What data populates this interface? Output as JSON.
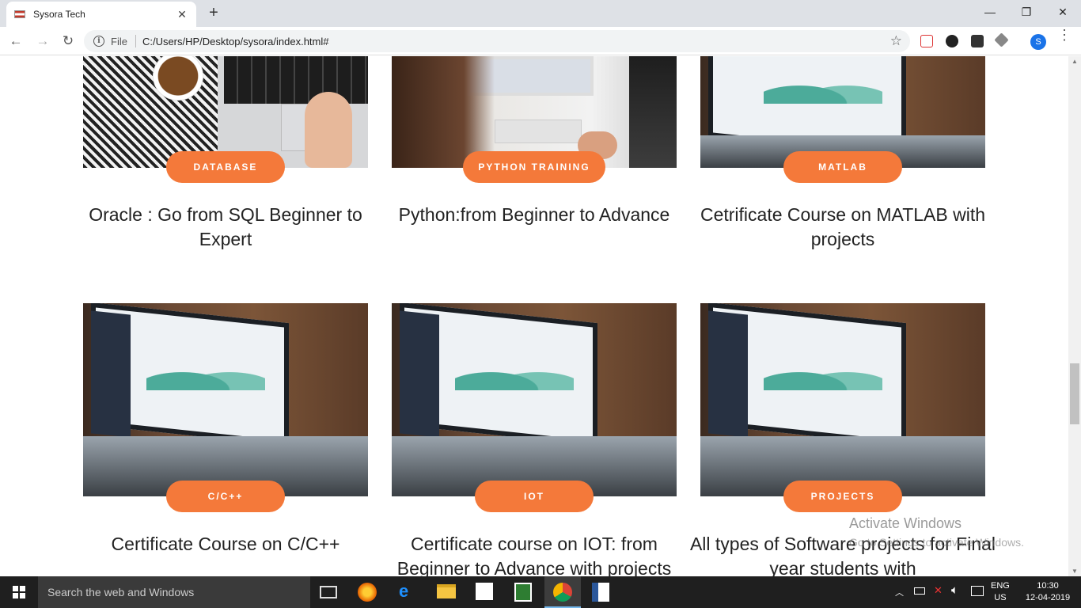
{
  "browser": {
    "tab_title": "Sysora Tech",
    "tab_close": "✕",
    "new_tab": "+",
    "win_min": "—",
    "win_restore": "❐",
    "win_close": "✕",
    "back": "←",
    "forward": "→",
    "reload": "↻",
    "info": "i",
    "file_label": "File",
    "url": "C:/Users/HP/Desktop/sysora/index.html#",
    "star": "☆",
    "avatar_letter": "S"
  },
  "courses": [
    {
      "category": "DATABASE",
      "title": "Oracle : Go from SQL Beginner to Expert"
    },
    {
      "category": "PYTHON TRAINING",
      "title": "Python:from Beginner to Advance"
    },
    {
      "category": "MATLAB",
      "title": "Cetrificate Course on MATLAB with projects"
    },
    {
      "category": "C/C++",
      "title": "Certificate Course on C/C++"
    },
    {
      "category": "IOT",
      "title": "Certificate course on IOT: from Beginner to Advance with projects"
    },
    {
      "category": "PROJECTS",
      "title": "All types of Software projects for Final year students with"
    }
  ],
  "colors": {
    "accent": "#f4793a",
    "text": "#222222",
    "taskbar": "#1f1f1f"
  },
  "watermark": {
    "title": "Activate Windows",
    "subtitle": "Go to Settings to activate Windows."
  },
  "taskbar": {
    "search_placeholder": "Search the web and Windows",
    "lang_top": "ENG",
    "lang_bottom": "US",
    "time": "10:30",
    "date": "12-04-2019"
  }
}
